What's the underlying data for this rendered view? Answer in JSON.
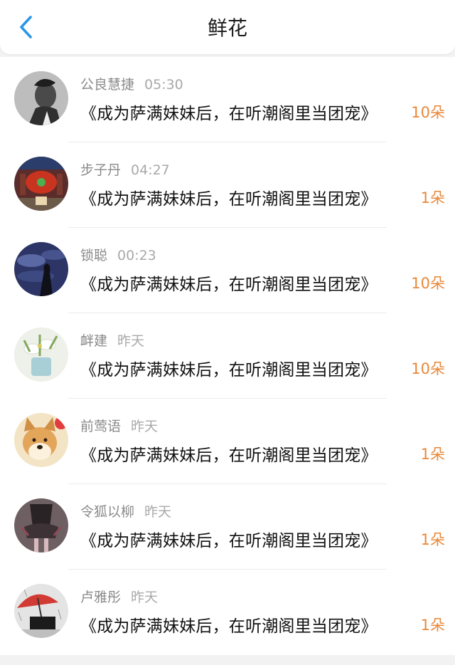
{
  "header": {
    "title": "鲜花",
    "back_icon": "chevron-left-icon",
    "accent_color": "#2a96e6"
  },
  "colors": {
    "amount": "#e8883a",
    "name": "#8a8a8a",
    "title": "#111111"
  },
  "records": [
    {
      "name": "公良慧捷",
      "time": "05:30",
      "book": "《成为萨满妹妹后，在听潮阁里当团宠》",
      "amount": "10朵",
      "avatar_icon": "avatar-man-portrait"
    },
    {
      "name": "步子丹",
      "time": "04:27",
      "book": "《成为萨满妹妹后，在听潮阁里当团宠》",
      "amount": "1朵",
      "avatar_icon": "avatar-red-lantern"
    },
    {
      "name": "锁聪",
      "time": "00:23",
      "book": "《成为萨满妹妹后，在听潮阁里当团宠》",
      "amount": "10朵",
      "avatar_icon": "avatar-night-sky-silhouette"
    },
    {
      "name": "衅建",
      "time": "昨天",
      "book": "《成为萨满妹妹后，在听潮阁里当团宠》",
      "amount": "10朵",
      "avatar_icon": "avatar-white-flowers"
    },
    {
      "name": "前莺语",
      "time": "昨天",
      "book": "《成为萨满妹妹后，在听潮阁里当团宠》",
      "amount": "1朵",
      "avatar_icon": "avatar-shiba-dog"
    },
    {
      "name": "令狐以柳",
      "time": "昨天",
      "book": "《成为萨满妹妹后，在听潮阁里当团宠》",
      "amount": "1朵",
      "avatar_icon": "avatar-dark-figure"
    },
    {
      "name": "卢雅彤",
      "time": "昨天",
      "book": "《成为萨满妹妹后，在听潮阁里当团宠》",
      "amount": "1朵",
      "avatar_icon": "avatar-red-umbrella"
    }
  ]
}
